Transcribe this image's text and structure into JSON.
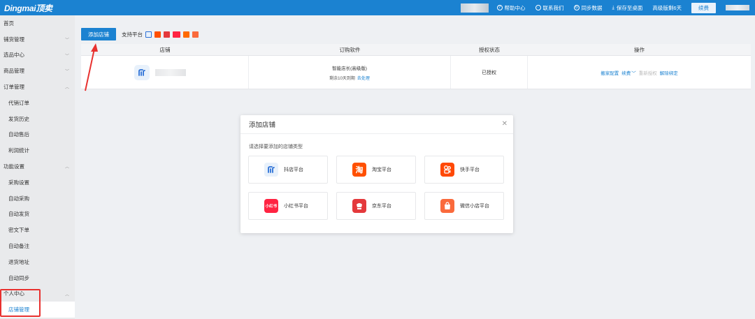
{
  "app": {
    "logo": "Dingmai顶卖"
  },
  "topbar": {
    "help": "帮助中心",
    "contact": "联系我们",
    "sync": "同步数据",
    "save_desktop": "保存至桌面",
    "plan_status": "高级版剩6天",
    "renew": "续费"
  },
  "sidebar": {
    "items": [
      {
        "label": "首页",
        "sub": false,
        "chevron": ""
      },
      {
        "label": "铺货管理",
        "sub": false,
        "chevron": "﹀"
      },
      {
        "label": "选品中心",
        "sub": false,
        "chevron": "﹀"
      },
      {
        "label": "商品管理",
        "sub": false,
        "chevron": "﹀"
      },
      {
        "label": "订单管理",
        "sub": false,
        "chevron": "︿"
      },
      {
        "label": "代销订单",
        "sub": true,
        "chevron": ""
      },
      {
        "label": "发货历史",
        "sub": true,
        "chevron": ""
      },
      {
        "label": "自动售后",
        "sub": true,
        "chevron": ""
      },
      {
        "label": "利润统计",
        "sub": true,
        "chevron": ""
      },
      {
        "label": "功能设置",
        "sub": false,
        "chevron": "︿"
      },
      {
        "label": "采购设置",
        "sub": true,
        "chevron": ""
      },
      {
        "label": "自动采购",
        "sub": true,
        "chevron": ""
      },
      {
        "label": "自动发货",
        "sub": true,
        "chevron": ""
      },
      {
        "label": "密文下单",
        "sub": true,
        "chevron": ""
      },
      {
        "label": "自动备注",
        "sub": true,
        "chevron": ""
      },
      {
        "label": "退货地址",
        "sub": true,
        "chevron": ""
      },
      {
        "label": "自动同步",
        "sub": true,
        "chevron": ""
      },
      {
        "label": "个人中心",
        "sub": false,
        "chevron": "︿"
      },
      {
        "label": "店铺管理",
        "sub": true,
        "chevron": "",
        "active": true
      }
    ]
  },
  "toolbar": {
    "add_shop": "添加店铺",
    "support_label": "支持平台"
  },
  "table": {
    "headers": [
      "店铺",
      "订购软件",
      "授权状态",
      "操作"
    ],
    "row": {
      "software": "智能店长(高级版)",
      "expire_text": "剩余10天到期",
      "expire_link": "去处理",
      "auth_status": "已授权",
      "op_config": "搬家配置",
      "op_renew": "续费",
      "op_reauth": "重新授权",
      "op_unbind": "解除绑定"
    }
  },
  "modal": {
    "title": "添加店铺",
    "hint": "请选择要添加的店铺类型",
    "platforms": [
      {
        "label": "抖店平台",
        "icon": "douyin-shop-icon",
        "color": "#e8f1fb"
      },
      {
        "label": "淘宝平台",
        "icon": "taobao-icon",
        "color": "#ff5000",
        "glyph": "淘"
      },
      {
        "label": "快手平台",
        "icon": "kuaishou-icon",
        "color": "#ff4906"
      },
      {
        "label": "小红书平台",
        "icon": "xiaohongshu-icon",
        "color": "#ff2442",
        "glyph": "小红书"
      },
      {
        "label": "京东平台",
        "icon": "jd-icon",
        "color": "#e4393c"
      },
      {
        "label": "微信小店平台",
        "icon": "wechat-shop-icon",
        "color": "#fa6a3c"
      }
    ]
  },
  "colors": {
    "primary": "#1b82d1",
    "highlight": "#e8312f"
  }
}
